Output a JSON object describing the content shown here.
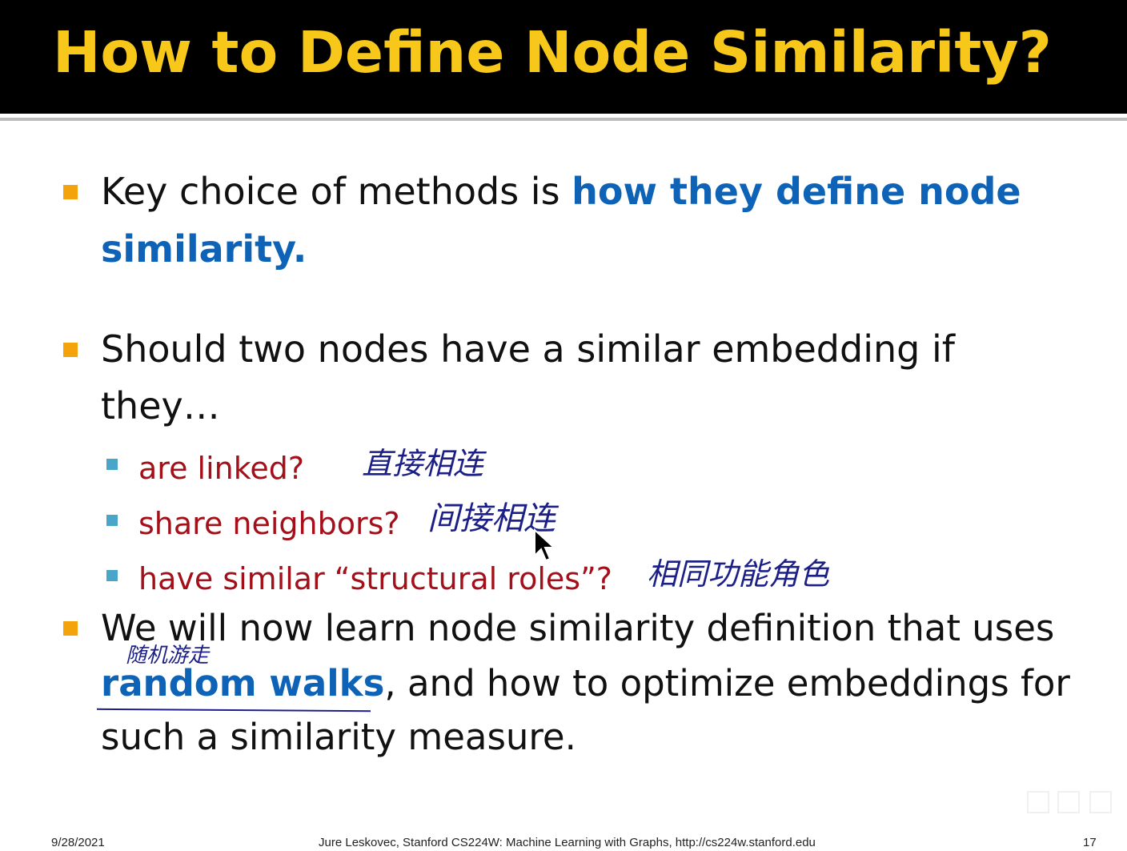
{
  "slide": {
    "title": "How to Define Node Similarity?",
    "bullets": {
      "b1_line1_plain": "Key choice of methods is ",
      "b1_line1_blue": "how they define node",
      "b1_line2_blue": "similarity.",
      "b2_line1": "Should two nodes have a similar embedding if",
      "b2_line2": "they…",
      "sub1": "are linked?",
      "sub2": "share neighbors?",
      "sub3": "have similar “structural roles”?",
      "b3_line1": "We will now learn node similarity definition that uses",
      "b3_line2_blue": "random walks",
      "b3_line2_plain": ", and how to optimize embeddings for",
      "b3_line3": "such a similarity measure."
    },
    "annotations": {
      "sub1_note": "直接相连",
      "sub2_note": "间接相连",
      "sub3_note": "相同功能角色",
      "random_walks_note": "随机游走"
    }
  },
  "footer": {
    "date": "9/28/2021",
    "credit": "Jure Leskovec, Stanford CS224W: Machine Learning with Graphs, http://cs224w.stanford.edu",
    "page_number": "17"
  },
  "colors": {
    "title": "#f7c81a",
    "accent_blue": "#0e63b6",
    "sub_red": "#a3101a",
    "bullet": "#f5a30d",
    "sub_bullet": "#4aa6c8",
    "ink": "#1c1f86"
  }
}
